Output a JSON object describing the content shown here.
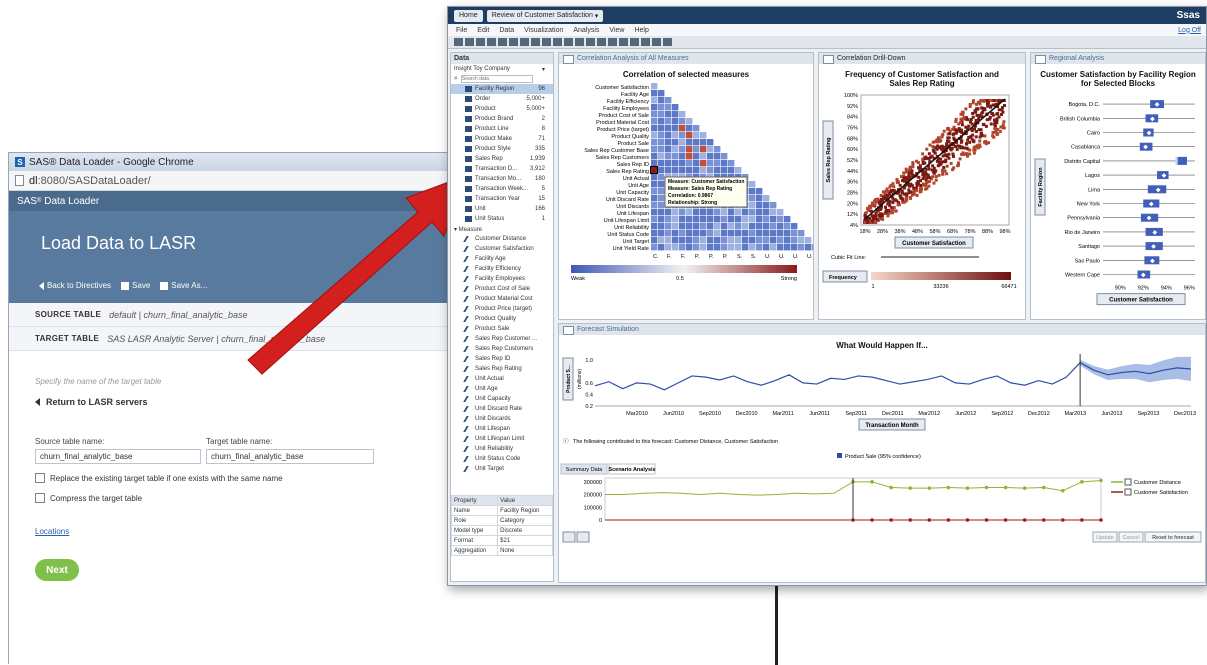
{
  "loader": {
    "window_title": "SAS® Data Loader - Google Chrome",
    "url_host": "dl",
    "url_rest": ":8080/SASDataLoader/",
    "app_name": "SAS",
    "app_suffix": "Data Loader",
    "page_title": "Load Data to LASR",
    "back_label": "Back to Directives",
    "save_label": "Save",
    "save_as_label": "Save As...",
    "source_key": "SOURCE TABLE",
    "source_val": "default | churn_final_analytic_base",
    "target_key": "TARGET TABLE",
    "target_val": "SAS LASR Analytic Server | churn_final_analytic_base",
    "specify_hint": "Specify the name of the target table",
    "return_label": "Return to LASR servers",
    "source_name_label": "Source table name:",
    "source_name_value": "churn_final_analytic_base",
    "target_name_label": "Target table name:",
    "target_name_value": "churn_final_analytic_base",
    "replace_label": "Replace the existing target table if one exists with the same name",
    "compress_label": "Compress the target table",
    "locations_link": "Locations",
    "next_label": "Next"
  },
  "va": {
    "home_tab": "Home",
    "report_tab": "Review of Customer Satisfaction",
    "logo": "Ssas",
    "menu": [
      "File",
      "Edit",
      "Data",
      "Visualization",
      "Analysis",
      "View",
      "Help"
    ],
    "logoff": "Log Off",
    "data_pane_title": "Data",
    "data_source": "Insight Toy Company",
    "search_placeholder": "Search data",
    "categories": [
      {
        "label": "Facility Region",
        "count": "96"
      },
      {
        "label": "Order",
        "count": "5,000+"
      },
      {
        "label": "Product",
        "count": "5,000+"
      },
      {
        "label": "Product Brand",
        "count": "2"
      },
      {
        "label": "Product Line",
        "count": "8"
      },
      {
        "label": "Product Make",
        "count": "71"
      },
      {
        "label": "Product Style",
        "count": "335"
      },
      {
        "label": "Sales Rep",
        "count": "1,939"
      },
      {
        "label": "Transaction D...",
        "count": "3,912"
      },
      {
        "label": "Transaction Mo...",
        "count": "180"
      },
      {
        "label": "Transaction Week...",
        "count": "5"
      },
      {
        "label": "Transaction Year",
        "count": "15"
      },
      {
        "label": "Unit",
        "count": "166"
      },
      {
        "label": "Unit Status",
        "count": "1"
      }
    ],
    "measures_label": "Measure",
    "measures": [
      "Customer Distance",
      "Customer Satisfaction",
      "Facility Age",
      "Facility Efficiency",
      "Facility Employees",
      "Product Cost of Sale",
      "Product Material Cost",
      "Product Price (target)",
      "Product Quality",
      "Product Sale",
      "Sales Rep Customer ...",
      "Sales Rep Customers",
      "Sales Rep ID",
      "Sales Rep Rating",
      "Unit Actual",
      "Unit Age",
      "Unit Capacity",
      "Unit Discard Rate",
      "Unit Discards",
      "Unit Lifespan",
      "Unit Lifespan Limit",
      "Unit Reliability",
      "Unit Status Code",
      "Unit Target"
    ],
    "properties": {
      "header": [
        "Property",
        "Value"
      ],
      "rows": [
        [
          "Name",
          "Facility Region"
        ],
        [
          "Role",
          "Category"
        ],
        [
          "Model type",
          "Discrete"
        ],
        [
          "Format",
          "$21"
        ],
        [
          "Aggregation",
          "None"
        ]
      ]
    },
    "corr_panel": {
      "tab": "Correlation Analysis of All Measures",
      "title": "Correlation of selected measures",
      "rows": [
        "Customer Satisfaction",
        "Facility Age",
        "Facility Efficiency",
        "Facility Employees",
        "Product Cost of Sale",
        "Product Material Cost",
        "Product Price (target)",
        "Product Quality",
        "Product Sale",
        "Sales Rep Customer Base",
        "Sales Rep Customers",
        "Sales Rep ID",
        "Sales Rep Rating",
        "Unit Actual",
        "Unit Age",
        "Unit Capacity",
        "Unit Discard Rate",
        "Unit Discards",
        "Unit Lifespan",
        "Unit Lifespan Limit",
        "Unit Reliability",
        "Unit Status Code",
        "Unit Target",
        "Unit Yield Rate"
      ],
      "col_labels": [
        "C.",
        "F.",
        "F.",
        "P.",
        "P.",
        "P.",
        "S.",
        "S.",
        "U.",
        "U.",
        "U.",
        "U."
      ],
      "tooltip": [
        "Measure: Customer Satisfaction",
        "Measure: Sales Rep Rating",
        "Correlation: 0.9867",
        "Relationship: Strong"
      ],
      "legend": {
        "weak": "Weak",
        "mid": "0.5",
        "strong": "Strong"
      }
    },
    "drill_panel": {
      "tab": "Correlation Drill-Down",
      "title": "Frequency of Customer Satisfaction and Sales Rep Rating",
      "y_axis": "Sales Rep Rating",
      "x_axis": "Customer Satisfaction",
      "ticks": [
        "100%",
        "92%",
        "84%",
        "76%",
        "68%",
        "60%",
        "52%",
        "44%",
        "36%",
        "28%",
        "20%",
        "12%",
        "4%"
      ],
      "x_ticks": [
        "18%",
        "28%",
        "38%",
        "48%",
        "58%",
        "68%",
        "78%",
        "88%",
        "98%"
      ],
      "fit_label": "Cubic Fit Line:",
      "freq_label": "Frequency",
      "freq_ticks": [
        "1",
        "33236",
        "66471"
      ]
    },
    "region_panel": {
      "tab": "Regional Analysis",
      "title": "Customer Satisfaction by Facility Region for Selected Blocks",
      "y_axis": "Facility Region",
      "x_axis": "Customer Satisfaction",
      "x_ticks": [
        "90%",
        "92%",
        "94%",
        "96%"
      ]
    },
    "forecast_panel": {
      "tab": "Forecast Simulation",
      "title": "What Would Happen If...",
      "y_label": "Product S...",
      "y_unit": "(millions)",
      "y_ticks": [
        "1.0",
        "0.6",
        "0.4",
        "0.2"
      ],
      "x_ticks": [
        "Mar2010",
        "Jun2010",
        "Sep2010",
        "Dec2010",
        "Mar2011",
        "Jun2011",
        "Sep2011",
        "Dec2011",
        "Mar2012",
        "Jun2012",
        "Sep2012",
        "Dec2012",
        "Mar2013",
        "Jun2013",
        "Sep2013",
        "Dec2013"
      ],
      "x_axis": "Transaction Month",
      "note": "The following contributed to this forecast: Customer Distance, Customer Satisfaction",
      "legend": "Product Sale (95% confidence)",
      "tabs": [
        "Summary Data",
        "Scenario Analysis"
      ],
      "scen_ticks": [
        "300000",
        "200000",
        "100000",
        "0"
      ],
      "series": [
        "Customer Distance",
        "Customer Satisfaction"
      ],
      "buttons": [
        "Update",
        "Cancel",
        "Reset to forecast"
      ]
    }
  },
  "chart_data": [
    {
      "type": "heatmap",
      "title": "Correlation of selected measures",
      "rows": [
        "Customer Satisfaction",
        "Facility Age",
        "Facility Efficiency",
        "Facility Employees",
        "Product Cost of Sale",
        "Product Material Cost",
        "Product Price (target)",
        "Product Quality",
        "Product Sale",
        "Sales Rep Customer Base",
        "Sales Rep Customers",
        "Sales Rep ID",
        "Sales Rep Rating",
        "Unit Actual",
        "Unit Age",
        "Unit Capacity",
        "Unit Discard Rate",
        "Unit Discards",
        "Unit Lifespan",
        "Unit Lifespan Limit",
        "Unit Reliability",
        "Unit Status Code",
        "Unit Target",
        "Unit Yield Rate"
      ],
      "highlight": {
        "row": "Sales Rep Rating",
        "col": "Customer Satisfaction",
        "value": 0.9867
      }
    },
    {
      "type": "scatter",
      "title": "Frequency of Customer Satisfaction and Sales Rep Rating",
      "xlabel": "Customer Satisfaction",
      "ylabel": "Sales Rep Rating",
      "xlim": [
        0.13,
        1.0
      ],
      "ylim": [
        0.0,
        1.0
      ],
      "freq_range": [
        1,
        66471
      ]
    },
    {
      "type": "bar",
      "title": "Customer Satisfaction by Facility Region for Selected Blocks",
      "categories": [
        "Bogota, D.C.",
        "British Columbia",
        "Cairo",
        "Casablanca",
        "Distrito Capital",
        "Lagos",
        "Lima",
        "New York",
        "Pennsylvania",
        "Rio de Janeiro",
        "Santiago",
        "Sao Paulo",
        "Western Cape"
      ],
      "q1": [
        0.926,
        0.922,
        0.92,
        0.917,
        0.948,
        0.932,
        0.924,
        0.92,
        0.918,
        0.922,
        0.922,
        0.921,
        0.915
      ],
      "q3": [
        0.938,
        0.933,
        0.929,
        0.928,
        0.957,
        0.942,
        0.94,
        0.934,
        0.933,
        0.937,
        0.937,
        0.934,
        0.926
      ],
      "median": [
        0.932,
        0.928,
        0.925,
        0.922,
        0.953,
        0.938,
        0.933,
        0.927,
        0.925,
        0.93,
        0.929,
        0.928,
        0.92
      ],
      "xlabel": "Customer Satisfaction",
      "xlim": [
        0.885,
        0.965
      ]
    },
    {
      "type": "line",
      "title": "What Would Happen If...",
      "ylabel": "Product S... (millions)",
      "xlabel": "Transaction Month",
      "ylim": [
        0.2,
        1.1
      ],
      "series": [
        {
          "name": "Product Sale (95% confidence)",
          "values": [
            0.55,
            0.62,
            0.5,
            0.6,
            0.58,
            0.48,
            0.6,
            0.72,
            0.7,
            0.65,
            0.72,
            0.62,
            0.56,
            0.64,
            0.74,
            0.6,
            0.58,
            0.68,
            0.66,
            0.72,
            0.7,
            0.64,
            0.58,
            0.62,
            0.66,
            0.72,
            0.6,
            0.58,
            0.66,
            0.72,
            0.6,
            0.56,
            0.64,
            0.58,
            0.7,
            0.95,
            0.82,
            0.74,
            0.78,
            0.8,
            0.76,
            0.82,
            0.86,
            0.84
          ]
        }
      ]
    },
    {
      "type": "line",
      "title": "",
      "ylim": [
        0,
        330000
      ],
      "series": [
        {
          "name": "Customer Distance",
          "values": [
            200000,
            200000,
            210000,
            215000,
            210000,
            200000,
            210000,
            200000,
            195000,
            200000,
            210000,
            205000,
            210000,
            300000,
            300000,
            255000,
            250000,
            250000,
            255000,
            250000,
            255000,
            255000,
            250000,
            255000,
            230000,
            300000,
            310000
          ]
        },
        {
          "name": "Customer Satisfaction",
          "values": [
            0,
            0,
            0,
            0,
            0,
            0,
            0,
            0,
            0,
            0,
            0,
            0,
            0,
            0,
            0,
            0,
            0,
            0,
            0,
            0,
            0,
            0,
            0,
            0,
            0,
            0,
            0
          ]
        }
      ]
    }
  ]
}
